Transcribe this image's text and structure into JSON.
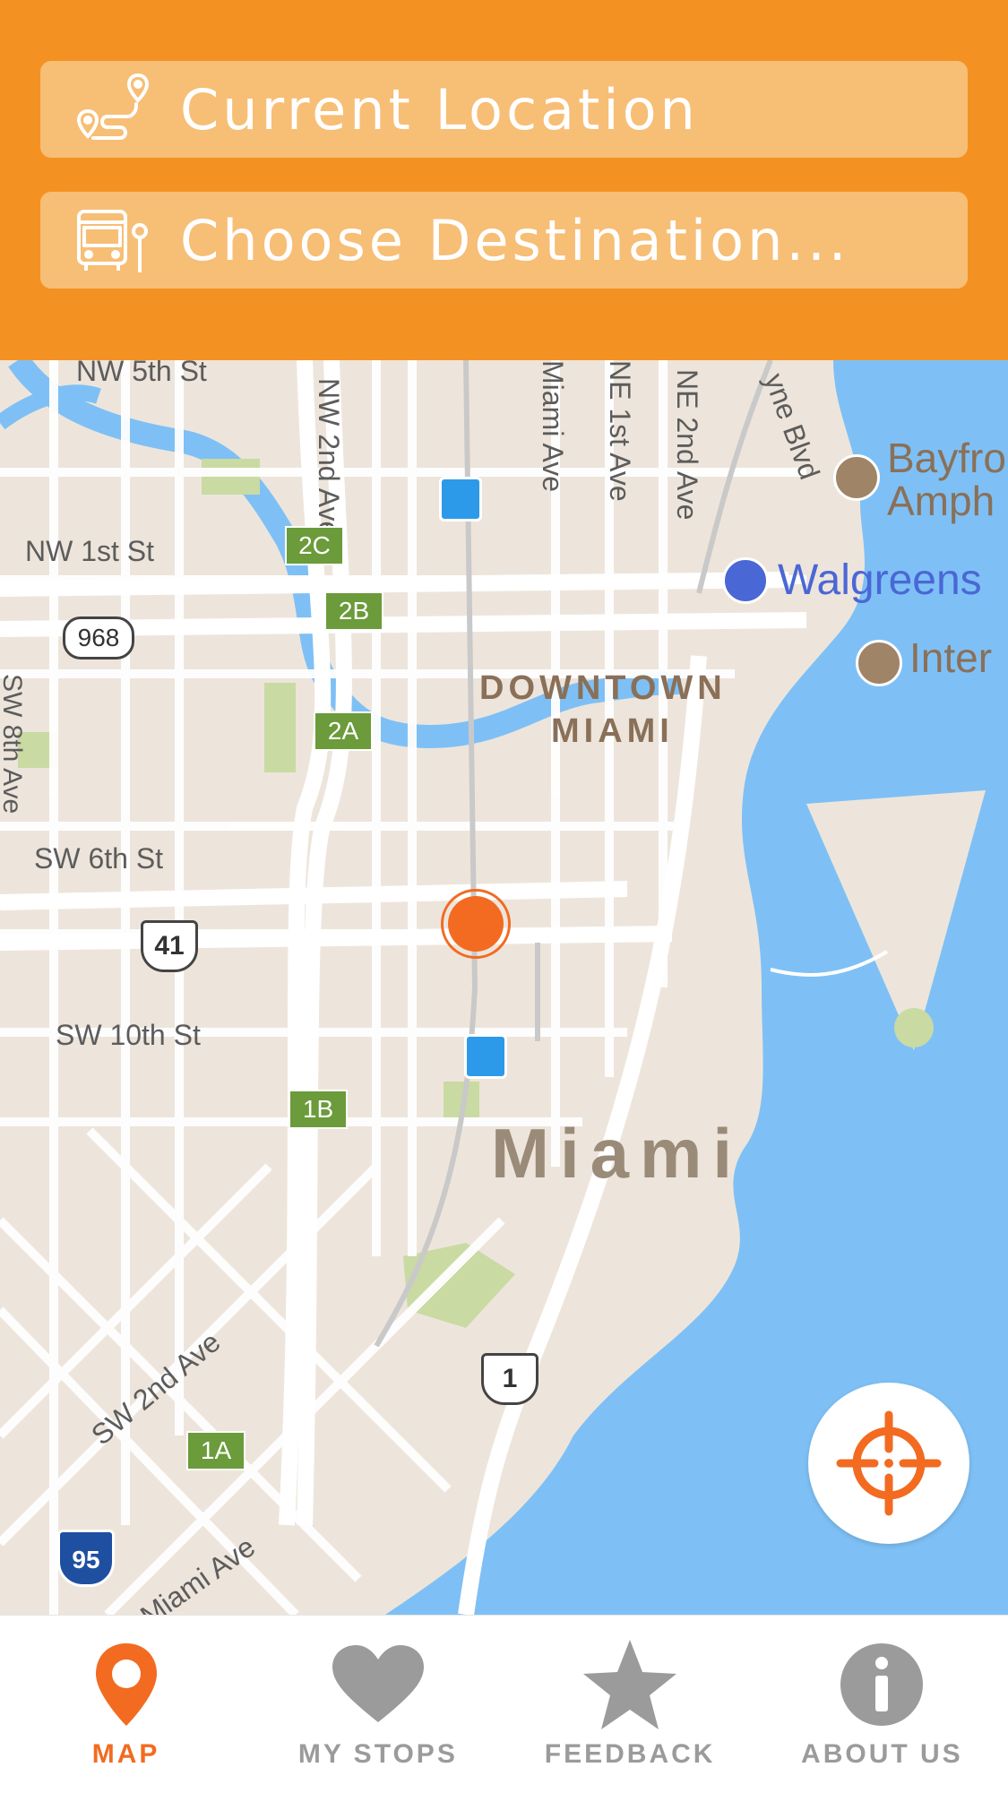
{
  "colors": {
    "header_bg": "#F39223",
    "field_bg": "#F7BE76",
    "accent": "#F26B21",
    "tab_inactive": "#9B9B9B",
    "water": "#7EC0F5",
    "land": "#EDE5DB"
  },
  "search": {
    "origin_label": "Current Location",
    "origin_icon": "route-pin-icon",
    "destination_label": "Choose Destination...",
    "destination_icon": "bus-stop-icon"
  },
  "map": {
    "labels": {
      "nw5": "NW 5th St",
      "nw1": "NW 1st St",
      "sw6": "SW 6th St",
      "sw10": "SW 10th St",
      "sw2ave": "SW 2nd Ave",
      "miami_ave": "Miami Ave",
      "miami_ave_n": "Miami Ave",
      "nw2ave": "NW 2nd Ave",
      "ne1ave": "NE 1st Ave",
      "ne2ave": "NE 2nd Ave",
      "biscayne": "yne Blvd",
      "downtown": "DOWNTOWN",
      "miami_district": "MIAMI",
      "city": "Miami",
      "walgreens": "Walgreens",
      "bayfront1": "Bayfro",
      "bayfront2": "Amph",
      "inter": "Inter",
      "sw8": "SW 8th Ave"
    },
    "shields": {
      "r968": "968",
      "us41": "41",
      "us1": "1",
      "i95": "95"
    },
    "exits": [
      "2C",
      "2B",
      "2A",
      "1B",
      "1A"
    ]
  },
  "tabs": [
    {
      "label": "MAP",
      "icon": "map-pin-icon",
      "active": true
    },
    {
      "label": "MY STOPS",
      "icon": "heart-icon",
      "active": false
    },
    {
      "label": "FEEDBACK",
      "icon": "star-icon",
      "active": false
    },
    {
      "label": "ABOUT US",
      "icon": "info-icon",
      "active": false
    }
  ]
}
